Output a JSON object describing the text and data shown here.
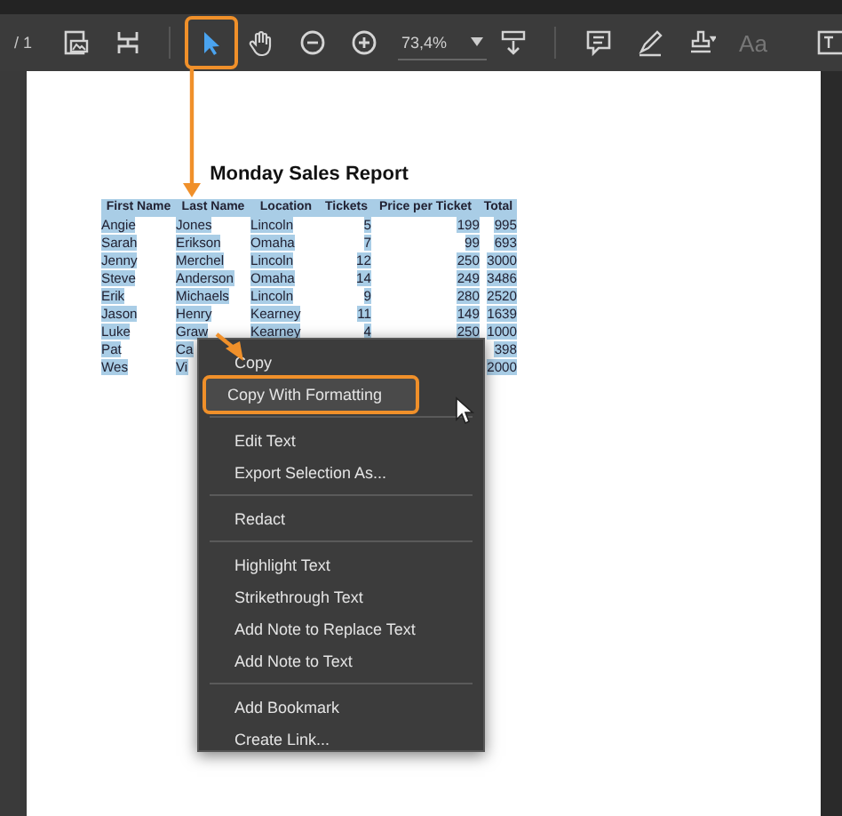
{
  "toolbar": {
    "page_count": "/ 1",
    "pointer_tools": [
      {
        "selected": true,
        "callout": true
      },
      {
        "selected": false,
        "callout": false
      }
    ],
    "zoom": "73,4%",
    "text_style": {
      "label": "Aa",
      "disabled": true
    }
  },
  "document": {
    "title": "Monday Sales Report",
    "columns": [
      "First Name",
      "Last Name",
      "Location",
      "Tickets",
      "Price per Ticket",
      "Total"
    ],
    "rows": [
      [
        "Angie",
        "Jones",
        "Lincoln",
        "5",
        "199",
        "995"
      ],
      [
        "Sarah",
        "Erikson",
        "Omaha",
        "7",
        "99",
        "693"
      ],
      [
        "Jenny",
        "Merchel",
        "Lincoln",
        "12",
        "250",
        "3000"
      ],
      [
        "Steve",
        "Anderson",
        "Omaha",
        "14",
        "249",
        "3486"
      ],
      [
        "Erik",
        "Michaels",
        "Lincoln",
        "9",
        "280",
        "2520"
      ],
      [
        "Jason",
        "Henry",
        "Kearney",
        "11",
        "149",
        "1639"
      ],
      [
        "Luke",
        "Graw",
        "Kearney",
        "4",
        "250",
        "1000"
      ],
      [
        "Pat",
        "Ca",
        "",
        "",
        "",
        "398"
      ],
      [
        "Wes",
        "Vi",
        "",
        "",
        "",
        "2000"
      ]
    ]
  },
  "context_menu": {
    "items": [
      {
        "kind": "item",
        "label": "Copy",
        "selected": false,
        "callout": false
      },
      {
        "kind": "item",
        "label": "Copy With Formatting",
        "selected": true,
        "callout": true
      },
      {
        "kind": "separator"
      },
      {
        "kind": "item",
        "label": "Edit Text",
        "selected": false,
        "callout": false
      },
      {
        "kind": "item",
        "label": "Export Selection As...",
        "selected": false,
        "callout": false
      },
      {
        "kind": "separator"
      },
      {
        "kind": "item",
        "label": "Redact",
        "selected": false,
        "callout": false
      },
      {
        "kind": "separator"
      },
      {
        "kind": "item",
        "label": "Highlight Text",
        "selected": false,
        "callout": false
      },
      {
        "kind": "item",
        "label": "Strikethrough Text",
        "selected": false,
        "callout": false
      },
      {
        "kind": "item",
        "label": "Add Note to Replace Text",
        "selected": false,
        "callout": false
      },
      {
        "kind": "item",
        "label": "Add Note to Text",
        "selected": false,
        "callout": false
      },
      {
        "kind": "separator"
      },
      {
        "kind": "item",
        "label": "Add Bookmark",
        "selected": false,
        "callout": false
      },
      {
        "kind": "item",
        "label": "Create Link...",
        "selected": false,
        "callout": false
      }
    ]
  }
}
